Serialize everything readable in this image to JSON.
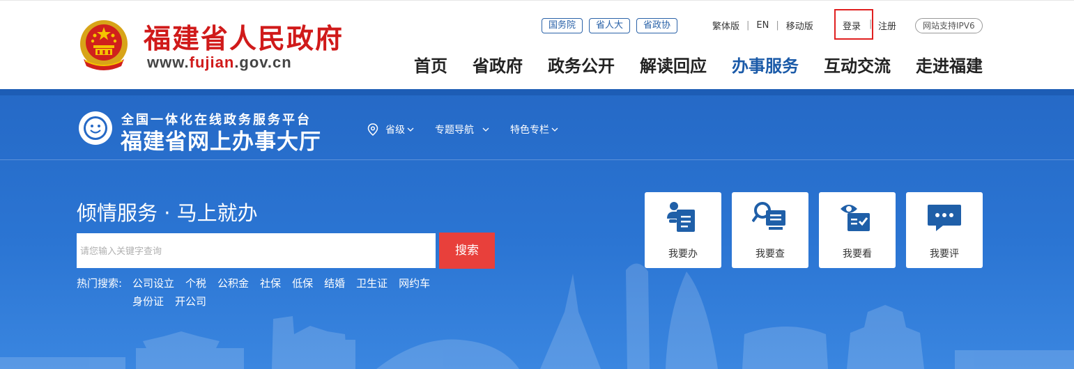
{
  "header": {
    "site_title": "福建省人民政府",
    "site_url_prefix": "www.",
    "site_url_highlight": "fujian",
    "site_url_suffix": ".gov.cn",
    "emblem_icon": "national-emblem-icon",
    "top_links": [
      "国务院",
      "省人大",
      "省政协"
    ],
    "util_links": [
      "繁体版",
      "EN",
      "移动版"
    ],
    "login": "登录",
    "register": "注册",
    "ipv6": "网站支持IPV6",
    "nav": [
      "首页",
      "省政府",
      "政务公开",
      "解读回应",
      "办事服务",
      "互动交流",
      "走进福建"
    ],
    "active_nav": "办事服务"
  },
  "hall": {
    "subtitle": "全国一体化在线政务服务平台",
    "title": "福建省网上办事大厅",
    "logo_icon": "smiley-service-logo-icon",
    "sub_nav": [
      "省级",
      "专题导航",
      "特色专栏"
    ]
  },
  "search": {
    "slogan": "倾情服务 · 马上就办",
    "placeholder": "请您输入关键字查询",
    "button": "搜索",
    "hot_label": "热门搜索:",
    "hot_row1": [
      "公司设立",
      "个税",
      "公积金",
      "社保",
      "低保",
      "结婚",
      "卫生证",
      "网约车"
    ],
    "hot_row2": [
      "身份证",
      "开公司"
    ]
  },
  "quick_cards": [
    {
      "label": "我要办",
      "icon": "person-clipboard-icon"
    },
    {
      "label": "我要查",
      "icon": "search-document-icon"
    },
    {
      "label": "我要看",
      "icon": "eye-checklist-icon"
    },
    {
      "label": "我要评",
      "icon": "chat-bubble-icon"
    }
  ],
  "colors": {
    "brand_red": "#d01a1a",
    "brand_blue": "#2569c6",
    "accent_red": "#e8403b",
    "icon_blue": "#1f5fa8"
  }
}
